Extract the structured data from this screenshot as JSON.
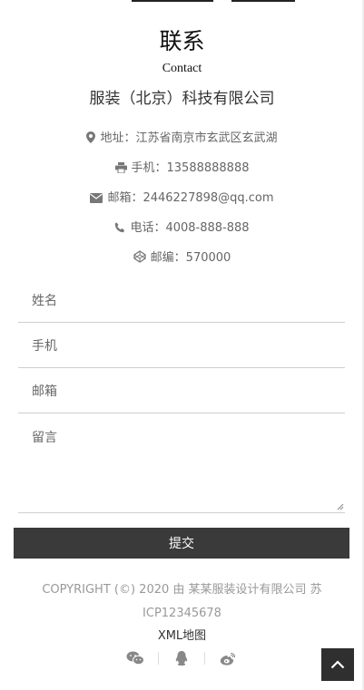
{
  "heading": {
    "title": "联系",
    "subtitle": "Contact"
  },
  "company": "服装（北京）科技有限公司",
  "contact_info": {
    "address": "地址：江苏省南京市玄武区玄武湖",
    "mobile": "手机：13588888888",
    "email": "邮箱：2446227898@qq.com",
    "phone": "电话：4008-888-888",
    "postcode": "邮编：570000"
  },
  "icons": {
    "address": "map-marker-icon",
    "mobile": "printer-icon",
    "email": "envelope-icon",
    "phone": "phone-icon",
    "postcode": "codepen-icon"
  },
  "form": {
    "name_placeholder": "姓名",
    "mobile_placeholder": "手机",
    "email_placeholder": "邮箱",
    "message_placeholder": "留言",
    "submit_label": "提交"
  },
  "footer": {
    "copyright": "COPYRIGHT (©) 2020 由 某某服装设计有限公司 苏ICP12345678",
    "sitemap": "XML地图"
  },
  "colors": {
    "button_bg": "#3a3a3a",
    "text": "#666666",
    "muted": "#999999"
  }
}
